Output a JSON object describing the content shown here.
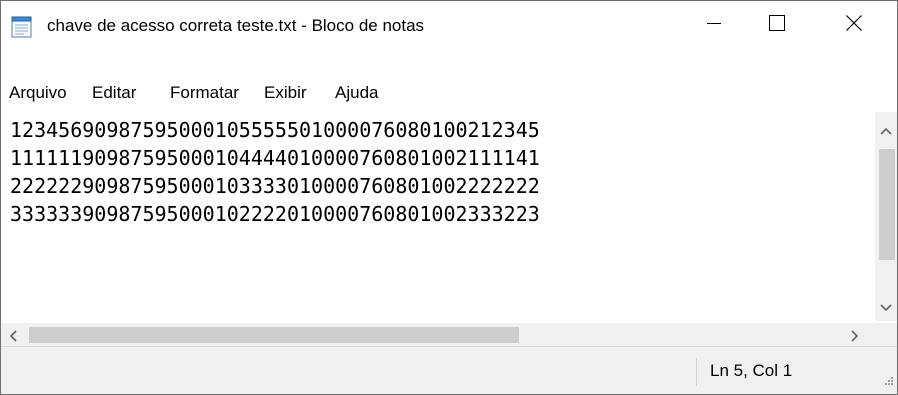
{
  "window": {
    "title": "chave de acesso correta teste.txt - Bloco de notas",
    "icon": "notepad-icon",
    "controls": [
      "minimize-icon",
      "maximize-icon",
      "close-icon"
    ]
  },
  "menu": {
    "items": [
      {
        "label": "Arquivo"
      },
      {
        "label": "Editar"
      },
      {
        "label": "Formatar"
      },
      {
        "label": "Exibir"
      },
      {
        "label": "Ajuda"
      }
    ]
  },
  "editor": {
    "lines": [
      "12345690987595000105555501000076080100212345",
      "11111190987595000104444010000760801002111141",
      "22222290987595000103333010000760801002222222",
      "33333390987595000102222010000760801002333223",
      ""
    ]
  },
  "scrollbars": {
    "vertical_icons": [
      "chevron-up-icon",
      "chevron-down-icon"
    ],
    "horizontal_icons": [
      "chevron-left-icon",
      "chevron-right-icon"
    ]
  },
  "status": {
    "position": "Ln 5, Col 1"
  },
  "colors": {
    "window_border": "#6f6f6f",
    "chrome_background": "#f0f0f0",
    "scroll_thumb": "#cdcdcd"
  }
}
